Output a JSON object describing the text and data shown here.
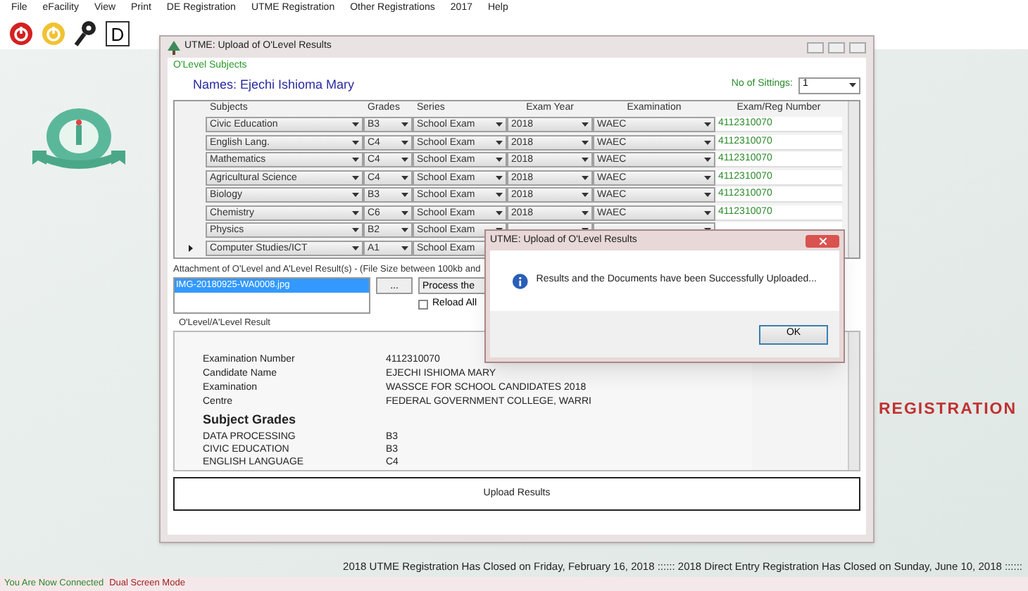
{
  "menu": [
    "File",
    "eFacility",
    "View",
    "Print",
    "DE Registration",
    "UTME Registration",
    "Other Registrations",
    "2017",
    "Help"
  ],
  "toolbar": {
    "key_label": "D"
  },
  "background": {
    "banner": "REGISTRATION"
  },
  "window": {
    "title": "UTME: Upload of O'Level Results",
    "group_label": "O'Level Subjects",
    "names": "Names: Ejechi Ishioma Mary",
    "sittings_label": "No of Sittings:",
    "sittings_value": "1",
    "columns": [
      "Subjects",
      "Grades",
      "Series",
      "Exam Year",
      "Examination",
      "Exam/Reg Number"
    ],
    "rows": [
      {
        "subject": "Civic Education",
        "grade": "B3",
        "series": "School Exam",
        "year": "2018",
        "exam": "WAEC",
        "reg": "4112310070",
        "current": false
      },
      {
        "subject": "English Lang.",
        "grade": "C4",
        "series": "School Exam",
        "year": "2018",
        "exam": "WAEC",
        "reg": "4112310070",
        "current": false
      },
      {
        "subject": "Mathematics",
        "grade": "C4",
        "series": "School Exam",
        "year": "2018",
        "exam": "WAEC",
        "reg": "4112310070",
        "current": false
      },
      {
        "subject": "Agricultural Science",
        "grade": "C4",
        "series": "School Exam",
        "year": "2018",
        "exam": "WAEC",
        "reg": "4112310070",
        "current": false
      },
      {
        "subject": "Biology",
        "grade": "B3",
        "series": "School Exam",
        "year": "2018",
        "exam": "WAEC",
        "reg": "4112310070",
        "current": false
      },
      {
        "subject": "Chemistry",
        "grade": "C6",
        "series": "School Exam",
        "year": "2018",
        "exam": "WAEC",
        "reg": "4112310070",
        "current": false
      },
      {
        "subject": "Physics",
        "grade": "B2",
        "series": "School Exam",
        "current": false
      },
      {
        "subject": "Computer Studies/ICT",
        "grade": "A1",
        "series": "School Exam",
        "current": true
      }
    ],
    "attachment_label": "Attachment of O'Level and A'Level Result(s) - (File Size between 100kb and",
    "files": [
      {
        "name": "IMG-20180925-WA0008.jpg",
        "selected": true
      }
    ],
    "browse_button": "...",
    "process_button": "Process the",
    "reload": {
      "label": "Reload All",
      "checked": false
    },
    "result_label": "O'Level/A'Level Result",
    "document": {
      "fields": [
        {
          "label": "Examination Number",
          "value": "4112310070"
        },
        {
          "label": "Candidate Name",
          "value": "EJECHI ISHIOMA MARY"
        },
        {
          "label": "Examination",
          "value": "WASSCE FOR SCHOOL CANDIDATES 2018"
        },
        {
          "label": "Centre",
          "value": "FEDERAL GOVERNMENT COLLEGE, WARRI"
        }
      ],
      "grades_heading": "Subject Grades",
      "grades": [
        {
          "subject": "DATA PROCESSING",
          "grade": "B3"
        },
        {
          "subject": "CIVIC EDUCATION",
          "grade": "B3"
        },
        {
          "subject": "ENGLISH LANGUAGE",
          "grade": "C4"
        }
      ]
    },
    "upload_button": "Upload Results"
  },
  "dialog": {
    "title": "UTME: Upload of O'Level Results",
    "message": "Results and the Documents have been Successfully Uploaded...",
    "ok": "OK"
  },
  "marquee": "2018 UTME Registration Has Closed on Friday, February 16, 2018 :::::: 2018 Direct Entry Registration Has Closed on Sunday, June 10, 2018 ::::::",
  "status": {
    "connection": "You Are Now Connected",
    "mode": "Dual Screen Mode"
  }
}
